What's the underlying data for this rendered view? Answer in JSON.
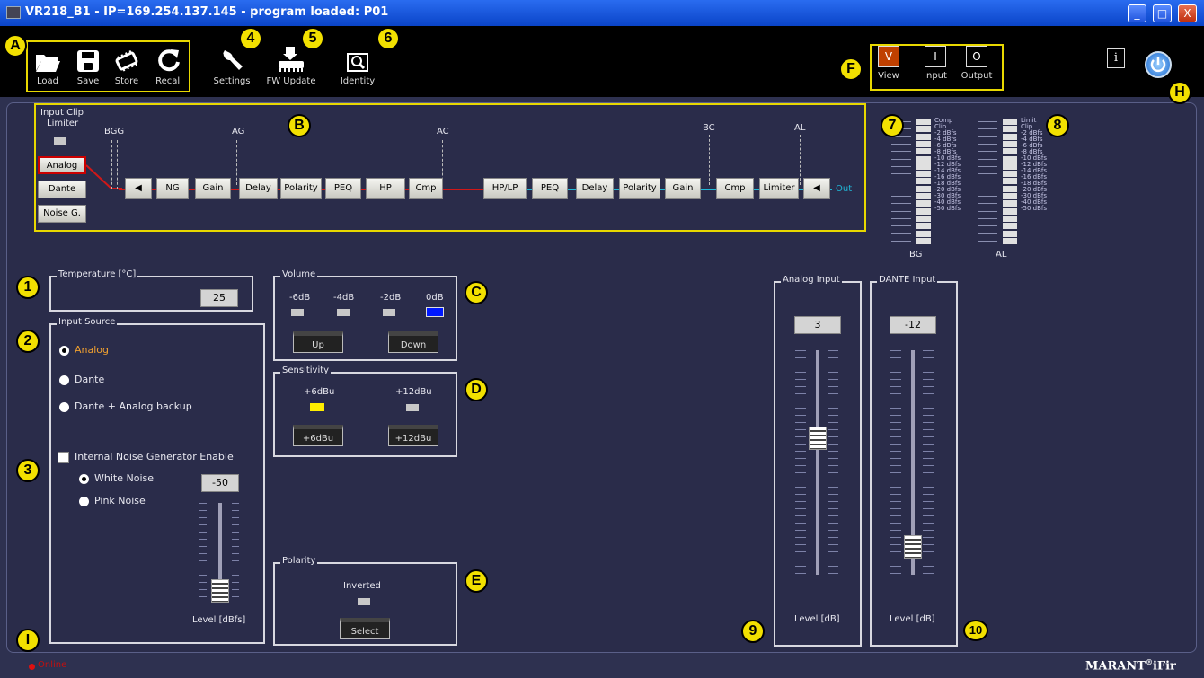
{
  "window": {
    "title": "VR218_B1 - IP=169.254.137.145 - program loaded: P01",
    "buttons": {
      "min": "_",
      "max": "□",
      "close": "X"
    }
  },
  "toolbar": {
    "file": [
      {
        "label": "Load",
        "icon": "folder-open-icon"
      },
      {
        "label": "Save",
        "icon": "floppy-icon"
      },
      {
        "label": "Store",
        "icon": "chip-icon"
      },
      {
        "label": "Recall",
        "icon": "refresh-icon"
      }
    ],
    "settings": "Settings",
    "fw_update": "FW Update",
    "identity": "Identity",
    "view_group": [
      {
        "letter": "V",
        "label": "View"
      },
      {
        "letter": "I",
        "label": "Input"
      },
      {
        "letter": "O",
        "label": "Output"
      }
    ],
    "info": "i"
  },
  "markers": {
    "A": "A",
    "B": "B",
    "C": "C",
    "D": "D",
    "E": "E",
    "F": "F",
    "H": "H",
    "I": "I",
    "n1": "1",
    "n2": "2",
    "n3": "3",
    "n4": "4",
    "n5": "5",
    "n6": "6",
    "n7": "7",
    "n8": "8",
    "n9": "9",
    "n10": "10"
  },
  "chain": {
    "input_clip": "Input Clip",
    "limiter": "Limiter",
    "sources": [
      "Analog",
      "Dante",
      "Noise G."
    ],
    "tap_labels": {
      "bgg": "BGG",
      "ag": "AG",
      "ac": "AC",
      "bc": "BC",
      "al": "AL"
    },
    "blocks": [
      "NG",
      "Gain",
      "Delay",
      "Polarity",
      "PEQ",
      "HP",
      "Cmp",
      "HP/LP",
      "PEQ",
      "Delay",
      "Polarity",
      "Gain",
      "Cmp",
      "Limiter"
    ],
    "out": "Out"
  },
  "meters": {
    "left": {
      "header": [
        "Comp",
        "Clip"
      ],
      "scale": [
        "-2 dBfs",
        "-4 dBfs",
        "-6 dBfs",
        "-8 dBfs",
        "-10 dBfs",
        "-12 dBfs",
        "-14 dBfs",
        "-16 dBfs",
        "-18 dBfs",
        "-20 dBfs",
        "-30 dBfs",
        "-40 dBfs",
        "-50 dBfs"
      ],
      "label": "BG"
    },
    "right": {
      "header": [
        "Limit",
        "Clip"
      ],
      "scale": [
        "-2 dBfs",
        "-4 dBfs",
        "-6 dBfs",
        "-8 dBfs",
        "-10 dBfs",
        "-12 dBfs",
        "-14 dBfs",
        "-16 dBfs",
        "-18 dBfs",
        "-20 dBfs",
        "-30 dBfs",
        "-40 dBfs",
        "-50 dBfs"
      ],
      "label": "AL"
    }
  },
  "temperature": {
    "legend": "Temperature [°C]",
    "value": "25"
  },
  "input_source": {
    "legend": "Input Source",
    "options": [
      "Analog",
      "Dante",
      "Dante + Analog backup"
    ],
    "selected": 0,
    "noise_enable": "Internal Noise Generator Enable",
    "noise_types": [
      "White Noise",
      "Pink Noise"
    ],
    "noise_selected": 0,
    "level_value": "-50",
    "level_label": "Level [dBfs]"
  },
  "volume": {
    "legend": "Volume",
    "steps": [
      "-6dB",
      "-4dB",
      "-2dB",
      "0dB"
    ],
    "active": 3,
    "up": "Up",
    "down": "Down"
  },
  "sensitivity": {
    "legend": "Sensitivity",
    "options": [
      "+6dBu",
      "+12dBu"
    ],
    "active": 0
  },
  "polarity": {
    "legend": "Polarity",
    "state": "Inverted",
    "button": "Select"
  },
  "analog_input": {
    "legend": "Analog Input",
    "value": "3",
    "label": "Level [dB]",
    "level": 0.62
  },
  "dante_input": {
    "legend": "DANTE Input",
    "value": "-12",
    "label": "Level [dB]",
    "level": 0.08
  },
  "status": {
    "text": "Online"
  },
  "brand": {
    "name": "MARANT",
    "reg": "®",
    "suffix": "iFir"
  },
  "colors": {
    "accent_yellow": "#f2e000",
    "active_blue": "#0018ff",
    "active_yellow": "#ffee00",
    "wire_red": "#d01818",
    "wire_cyan": "#20b8d8"
  }
}
